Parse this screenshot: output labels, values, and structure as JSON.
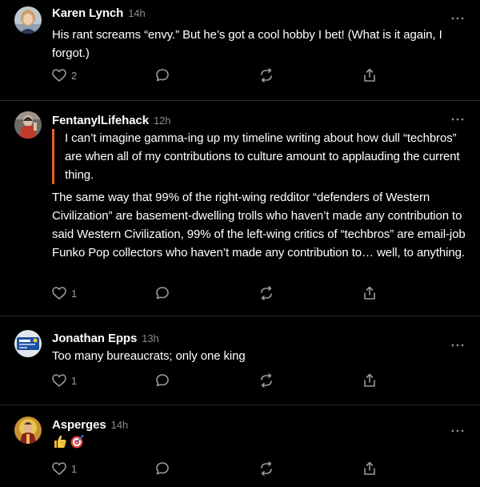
{
  "posts": [
    {
      "author": "Karen Lynch",
      "time": "14h",
      "quote": null,
      "body": "His rant screams “envy.” But he’s got a cool hobby I bet! (What is it again, I forgot.)",
      "likes": "2"
    },
    {
      "author": "FentanylLifehack",
      "time": "12h",
      "quote": "I can’t imagine gamma-ing up my timeline writing about how dull “techbros” are when all of my contributions to culture amount to applauding the current thing.",
      "body": "The same way that 99% of the right-wing redditor “defenders of Western Civilization” are basement-dwelling trolls who haven’t made any contribution to said Western Civilization, 99% of the left-wing critics of “techbros” are email-job Funko Pop collectors who haven’t made any contribution to… well, to anything.",
      "likes": "1"
    },
    {
      "author": "Jonathan Epps",
      "time": "13h",
      "quote": null,
      "body": "Too many bureaucrats; only one king",
      "likes": "1"
    },
    {
      "author": "Asperges",
      "time": "14h",
      "quote": null,
      "body": "",
      "emojis": [
        "thumbs-up",
        "direct-hit"
      ],
      "likes": "1"
    }
  ],
  "colors": {
    "background": "#000000",
    "text": "#ffffff",
    "muted": "#8a8a8f",
    "quote_bar": "#e8601c",
    "divider": "#2a2a2c"
  },
  "icons": {
    "like": "heart-icon",
    "reply": "comment-icon",
    "restack": "restack-icon",
    "share": "share-icon",
    "more": "more-dots-icon"
  }
}
